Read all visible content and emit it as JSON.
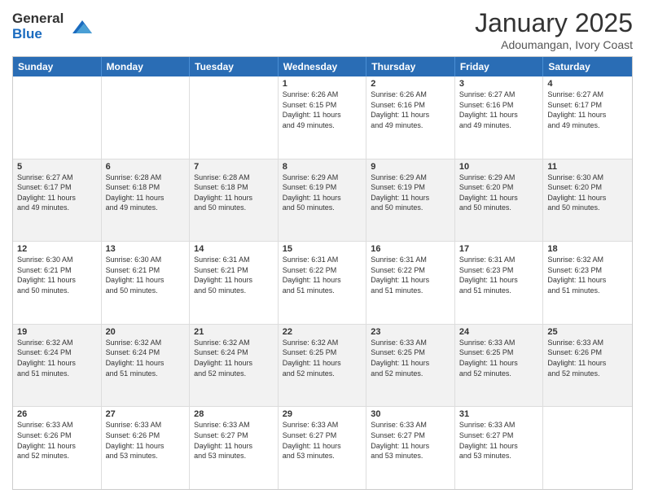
{
  "header": {
    "logo_line1": "General",
    "logo_line2": "Blue",
    "month": "January 2025",
    "location": "Adoumangan, Ivory Coast"
  },
  "weekdays": [
    "Sunday",
    "Monday",
    "Tuesday",
    "Wednesday",
    "Thursday",
    "Friday",
    "Saturday"
  ],
  "rows": [
    [
      {
        "day": "",
        "info": ""
      },
      {
        "day": "",
        "info": ""
      },
      {
        "day": "",
        "info": ""
      },
      {
        "day": "1",
        "info": "Sunrise: 6:26 AM\nSunset: 6:15 PM\nDaylight: 11 hours\nand 49 minutes."
      },
      {
        "day": "2",
        "info": "Sunrise: 6:26 AM\nSunset: 6:16 PM\nDaylight: 11 hours\nand 49 minutes."
      },
      {
        "day": "3",
        "info": "Sunrise: 6:27 AM\nSunset: 6:16 PM\nDaylight: 11 hours\nand 49 minutes."
      },
      {
        "day": "4",
        "info": "Sunrise: 6:27 AM\nSunset: 6:17 PM\nDaylight: 11 hours\nand 49 minutes."
      }
    ],
    [
      {
        "day": "5",
        "info": "Sunrise: 6:27 AM\nSunset: 6:17 PM\nDaylight: 11 hours\nand 49 minutes."
      },
      {
        "day": "6",
        "info": "Sunrise: 6:28 AM\nSunset: 6:18 PM\nDaylight: 11 hours\nand 49 minutes."
      },
      {
        "day": "7",
        "info": "Sunrise: 6:28 AM\nSunset: 6:18 PM\nDaylight: 11 hours\nand 50 minutes."
      },
      {
        "day": "8",
        "info": "Sunrise: 6:29 AM\nSunset: 6:19 PM\nDaylight: 11 hours\nand 50 minutes."
      },
      {
        "day": "9",
        "info": "Sunrise: 6:29 AM\nSunset: 6:19 PM\nDaylight: 11 hours\nand 50 minutes."
      },
      {
        "day": "10",
        "info": "Sunrise: 6:29 AM\nSunset: 6:20 PM\nDaylight: 11 hours\nand 50 minutes."
      },
      {
        "day": "11",
        "info": "Sunrise: 6:30 AM\nSunset: 6:20 PM\nDaylight: 11 hours\nand 50 minutes."
      }
    ],
    [
      {
        "day": "12",
        "info": "Sunrise: 6:30 AM\nSunset: 6:21 PM\nDaylight: 11 hours\nand 50 minutes."
      },
      {
        "day": "13",
        "info": "Sunrise: 6:30 AM\nSunset: 6:21 PM\nDaylight: 11 hours\nand 50 minutes."
      },
      {
        "day": "14",
        "info": "Sunrise: 6:31 AM\nSunset: 6:21 PM\nDaylight: 11 hours\nand 50 minutes."
      },
      {
        "day": "15",
        "info": "Sunrise: 6:31 AM\nSunset: 6:22 PM\nDaylight: 11 hours\nand 51 minutes."
      },
      {
        "day": "16",
        "info": "Sunrise: 6:31 AM\nSunset: 6:22 PM\nDaylight: 11 hours\nand 51 minutes."
      },
      {
        "day": "17",
        "info": "Sunrise: 6:31 AM\nSunset: 6:23 PM\nDaylight: 11 hours\nand 51 minutes."
      },
      {
        "day": "18",
        "info": "Sunrise: 6:32 AM\nSunset: 6:23 PM\nDaylight: 11 hours\nand 51 minutes."
      }
    ],
    [
      {
        "day": "19",
        "info": "Sunrise: 6:32 AM\nSunset: 6:24 PM\nDaylight: 11 hours\nand 51 minutes."
      },
      {
        "day": "20",
        "info": "Sunrise: 6:32 AM\nSunset: 6:24 PM\nDaylight: 11 hours\nand 51 minutes."
      },
      {
        "day": "21",
        "info": "Sunrise: 6:32 AM\nSunset: 6:24 PM\nDaylight: 11 hours\nand 52 minutes."
      },
      {
        "day": "22",
        "info": "Sunrise: 6:32 AM\nSunset: 6:25 PM\nDaylight: 11 hours\nand 52 minutes."
      },
      {
        "day": "23",
        "info": "Sunrise: 6:33 AM\nSunset: 6:25 PM\nDaylight: 11 hours\nand 52 minutes."
      },
      {
        "day": "24",
        "info": "Sunrise: 6:33 AM\nSunset: 6:25 PM\nDaylight: 11 hours\nand 52 minutes."
      },
      {
        "day": "25",
        "info": "Sunrise: 6:33 AM\nSunset: 6:26 PM\nDaylight: 11 hours\nand 52 minutes."
      }
    ],
    [
      {
        "day": "26",
        "info": "Sunrise: 6:33 AM\nSunset: 6:26 PM\nDaylight: 11 hours\nand 52 minutes."
      },
      {
        "day": "27",
        "info": "Sunrise: 6:33 AM\nSunset: 6:26 PM\nDaylight: 11 hours\nand 53 minutes."
      },
      {
        "day": "28",
        "info": "Sunrise: 6:33 AM\nSunset: 6:27 PM\nDaylight: 11 hours\nand 53 minutes."
      },
      {
        "day": "29",
        "info": "Sunrise: 6:33 AM\nSunset: 6:27 PM\nDaylight: 11 hours\nand 53 minutes."
      },
      {
        "day": "30",
        "info": "Sunrise: 6:33 AM\nSunset: 6:27 PM\nDaylight: 11 hours\nand 53 minutes."
      },
      {
        "day": "31",
        "info": "Sunrise: 6:33 AM\nSunset: 6:27 PM\nDaylight: 11 hours\nand 53 minutes."
      },
      {
        "day": "",
        "info": ""
      }
    ]
  ]
}
